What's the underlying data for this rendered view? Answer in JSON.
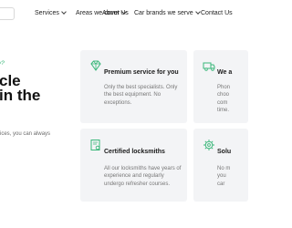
{
  "nav": {
    "items": [
      {
        "label": "Services",
        "dropdown": true
      },
      {
        "label": "Areas we cover",
        "dropdown": true
      },
      {
        "label": "About Us",
        "dropdown": false
      },
      {
        "label": "Car brands we serve",
        "dropdown": true
      },
      {
        "label": "Contact Us",
        "dropdown": false
      }
    ]
  },
  "hero": {
    "tagline": "y?",
    "line1": "cle",
    "line2": "in the",
    "subtext": "ices, you can always"
  },
  "cards": [
    {
      "title": "Premium service for you",
      "icon": "diamond-icon",
      "text": "Only the best specialists. Only\nthe best equipment. No\nexceptions."
    },
    {
      "title": "We a",
      "icon": "truck-icon",
      "text": "Phon\nchoo\ncom\ntime."
    },
    {
      "title": "Certified locksmiths",
      "icon": "certificate-icon",
      "text": "All our locksmiths have years of\nexperience and regularly\nundergo refresher courses."
    },
    {
      "title": "Solu",
      "icon": "gear-icon",
      "text": "No m\nyou \ncar "
    }
  ],
  "colors": {
    "accent": "#3ab77a",
    "card_bg": "#f3f4f6"
  }
}
